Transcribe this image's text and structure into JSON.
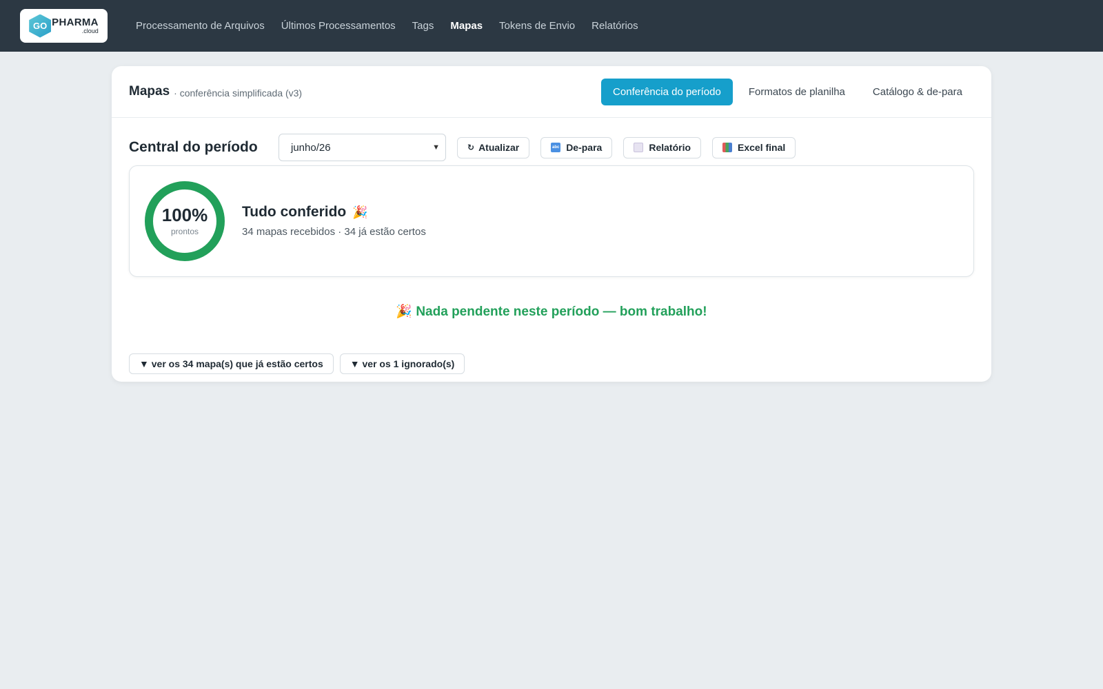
{
  "logo": {
    "mark": "GO",
    "word": "PHARMA",
    "sub": ".cloud"
  },
  "nav": {
    "items": [
      {
        "label": "Processamento de Arquivos"
      },
      {
        "label": "Últimos Processamentos"
      },
      {
        "label": "Tags"
      },
      {
        "label": "Mapas",
        "active": true
      },
      {
        "label": "Tokens de Envio"
      },
      {
        "label": "Relatórios"
      }
    ]
  },
  "card": {
    "title": "Mapas",
    "subtitle": "· conferência simplificada (v3)",
    "tabs": [
      {
        "label": "Conferência do período",
        "active": true
      },
      {
        "label": "Formatos de planilha"
      },
      {
        "label": "Catálogo & de-para"
      }
    ]
  },
  "toolbar": {
    "section_title": "Central do período",
    "period_value": "junho/26",
    "refresh_label": "Atualizar",
    "depara_label": "De-para",
    "report_label": "Relatório",
    "excel_label": "Excel final"
  },
  "status": {
    "percent": "100%",
    "percent_label": "prontos",
    "title": "Tudo conferido",
    "summary": "34 mapas recebidos · 34 já estão certos",
    "ring_color": "#22a05a"
  },
  "message": "Nada pendente neste período — bom trabalho!",
  "footer": {
    "show_correct_label": "▼ ver os 34 mapa(s) que já estão certos",
    "show_ignored_label": "▼ ver os 1 ignorado(s)"
  },
  "colors": {
    "accent": "#169fcb",
    "success": "#22a05a",
    "topbar": "#2c3843"
  }
}
